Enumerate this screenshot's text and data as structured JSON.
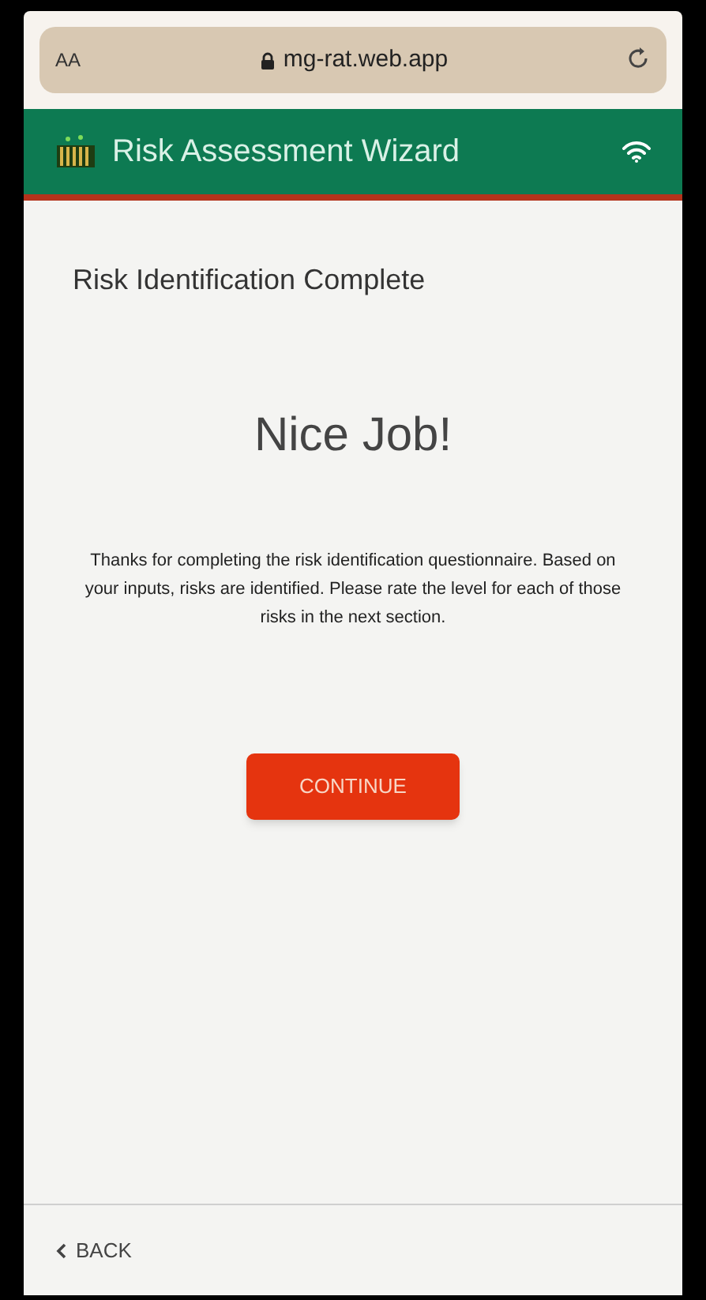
{
  "browser_bar": {
    "text_size_button": "AA",
    "url": "mg-rat.web.app"
  },
  "header": {
    "title": "Risk Assessment Wizard"
  },
  "page": {
    "heading": "Risk Identification Complete",
    "headline": "Nice Job!",
    "message": "Thanks for completing the risk identification questionnaire. Based on your inputs, risks are identified. Please rate the level for each of those risks in the next section.",
    "button": "CONTINUE"
  },
  "footer": {
    "back_button": "BACK"
  }
}
